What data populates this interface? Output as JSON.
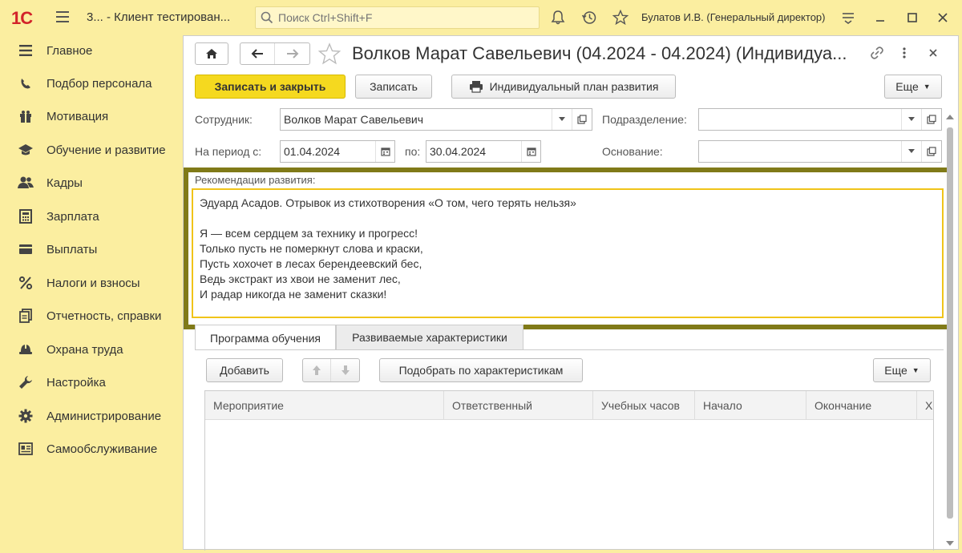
{
  "app": {
    "title": "3...  - Клиент тестирован...",
    "search_placeholder": "Поиск Ctrl+Shift+F",
    "user": "Булатов И.В. (Генеральный директор)",
    "logo_text": "1С"
  },
  "sidebar": {
    "items": [
      {
        "label": "Главное",
        "icon": "menu-lines-icon"
      },
      {
        "label": "Подбор персонала",
        "icon": "recruit-icon"
      },
      {
        "label": "Мотивация",
        "icon": "gift-icon"
      },
      {
        "label": "Обучение и развитие",
        "icon": "graduation-cap-icon"
      },
      {
        "label": "Кадры",
        "icon": "people-icon"
      },
      {
        "label": "Зарплата",
        "icon": "calculator-icon"
      },
      {
        "label": "Выплаты",
        "icon": "card-icon"
      },
      {
        "label": "Налоги и взносы",
        "icon": "percent-icon"
      },
      {
        "label": "Отчетность, справки",
        "icon": "reports-icon"
      },
      {
        "label": "Охрана труда",
        "icon": "helmet-icon"
      },
      {
        "label": "Настройка",
        "icon": "wrench-icon"
      },
      {
        "label": "Администрирование",
        "icon": "gear-icon"
      },
      {
        "label": "Самообслуживание",
        "icon": "id-card-icon"
      }
    ]
  },
  "document": {
    "title": "Волков Марат Савельевич (04.2024 - 04.2024) (Индивидуа...",
    "toolbar": {
      "save_close": "Записать и закрыть",
      "save": "Записать",
      "plan": "Индивидуальный план развития",
      "more": "Еще"
    },
    "fields": {
      "employee_label": "Сотрудник:",
      "employee_value": "Волков Марат Савельевич",
      "period_label": "На период с:",
      "period_from": "01.04.2024",
      "period_to_label": "по:",
      "period_to": "30.04.2024",
      "department_label": "Подразделение:",
      "department_value": "",
      "basis_label": "Основание:",
      "basis_value": ""
    },
    "recommendations": {
      "label": "Рекомендации развития:",
      "text": "Эдуард Асадов. Отрывок из стихотворения «О том, чего терять нельзя»\n\nЯ — всем сердцем за технику и прогресс!\nТолько пусть не померкнут слова и краски,\nПусть хохочет в лесах берендеевский бес,\nВедь экстракт из хвои не заменит лес,\nИ радар никогда не заменит сказки!"
    },
    "tabs": [
      {
        "label": "Программа обучения",
        "active": true
      },
      {
        "label": "Развиваемые характеристики",
        "active": false
      }
    ],
    "table_toolbar": {
      "add": "Добавить",
      "pick": "Подобрать по характеристикам",
      "more": "Еще"
    },
    "table": {
      "columns": [
        "Мероприятие",
        "Ответственный",
        "Учебных часов",
        "Начало",
        "Окончание",
        "Х"
      ],
      "rows": []
    }
  },
  "colors": {
    "panel_bg": "#fbeea0",
    "primary_button": "#f5d91f",
    "highlight_frame": "#807a18",
    "field_focus": "#f0c419"
  }
}
